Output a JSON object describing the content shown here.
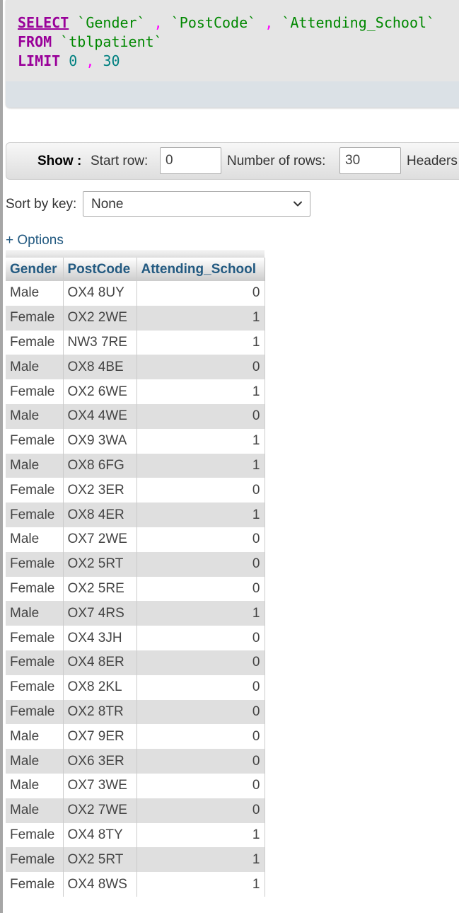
{
  "sql": {
    "select_kw": "SELECT",
    "field1": "`Gender`",
    "comma": ",",
    "field2": "`PostCode`",
    "field3": "`Attending_School`",
    "from_kw": "FROM",
    "table": "`tblpatient`",
    "limit_kw": "LIMIT",
    "limit_start": "0",
    "limit_count": "30"
  },
  "navigation": {
    "show_label": "Show :",
    "start_row_label": "Start row:",
    "start_row_value": "0",
    "num_rows_label": "Number of rows:",
    "num_rows_value": "30",
    "headers_label": "Headers"
  },
  "sort": {
    "label": "Sort by key:",
    "selected": "None"
  },
  "options_link": "+ Options",
  "table": {
    "columns": [
      "Gender",
      "PostCode",
      "Attending_School"
    ],
    "rows": [
      [
        "Male",
        "OX4 8UY",
        "0"
      ],
      [
        "Female",
        "OX2 2WE",
        "1"
      ],
      [
        "Female",
        "NW3 7RE",
        "1"
      ],
      [
        "Male",
        "OX8 4BE",
        "0"
      ],
      [
        "Female",
        "OX2 6WE",
        "1"
      ],
      [
        "Male",
        "OX4 4WE",
        "0"
      ],
      [
        "Female",
        "OX9 3WA",
        "1"
      ],
      [
        "Male",
        "OX8 6FG",
        "1"
      ],
      [
        "Female",
        "OX2 3ER",
        "0"
      ],
      [
        "Female",
        "OX8 4ER",
        "1"
      ],
      [
        "Male",
        "OX7 2WE",
        "0"
      ],
      [
        "Female",
        "OX2 5RT",
        "0"
      ],
      [
        "Female",
        "OX2 5RE",
        "0"
      ],
      [
        "Male",
        "OX7 4RS",
        "1"
      ],
      [
        "Female",
        "OX4 3JH",
        "0"
      ],
      [
        "Female",
        "OX4 8ER",
        "0"
      ],
      [
        "Female",
        "OX8 2KL",
        "0"
      ],
      [
        "Female",
        "OX2 8TR",
        "0"
      ],
      [
        "Male",
        "OX7 9ER",
        "0"
      ],
      [
        "Male",
        "OX6 3ER",
        "0"
      ],
      [
        "Male",
        "OX7 3WE",
        "0"
      ],
      [
        "Male",
        "OX2 7WE",
        "0"
      ],
      [
        "Female",
        "OX4 8TY",
        "1"
      ],
      [
        "Female",
        "OX2 5RT",
        "1"
      ],
      [
        "Female",
        "OX4 8WS",
        "1"
      ]
    ]
  },
  "colors": {
    "keyword": "#990099",
    "identifier": "#008800",
    "number": "#008080",
    "link": "#235a81"
  }
}
